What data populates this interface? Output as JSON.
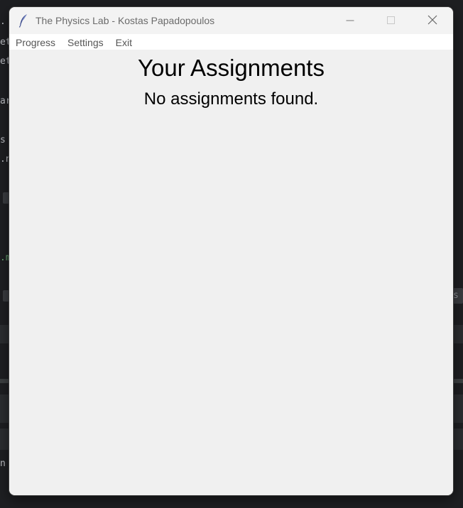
{
  "window": {
    "title": "The Physics Lab - Kostas Papadopoulos",
    "icon": "feather-icon",
    "controls": [
      "minimize-icon",
      "maximize-icon",
      "close-icon"
    ]
  },
  "menubar": {
    "items": [
      {
        "label": "Progress"
      },
      {
        "label": "Settings"
      },
      {
        "label": "Exit"
      }
    ]
  },
  "main": {
    "heading": "Your Assignments",
    "empty_message": "No assignments found."
  },
  "colors": {
    "window_background": "#f0f0f0",
    "menubar_background": "#ffffff",
    "desktop_background": "#1e1f22"
  }
}
